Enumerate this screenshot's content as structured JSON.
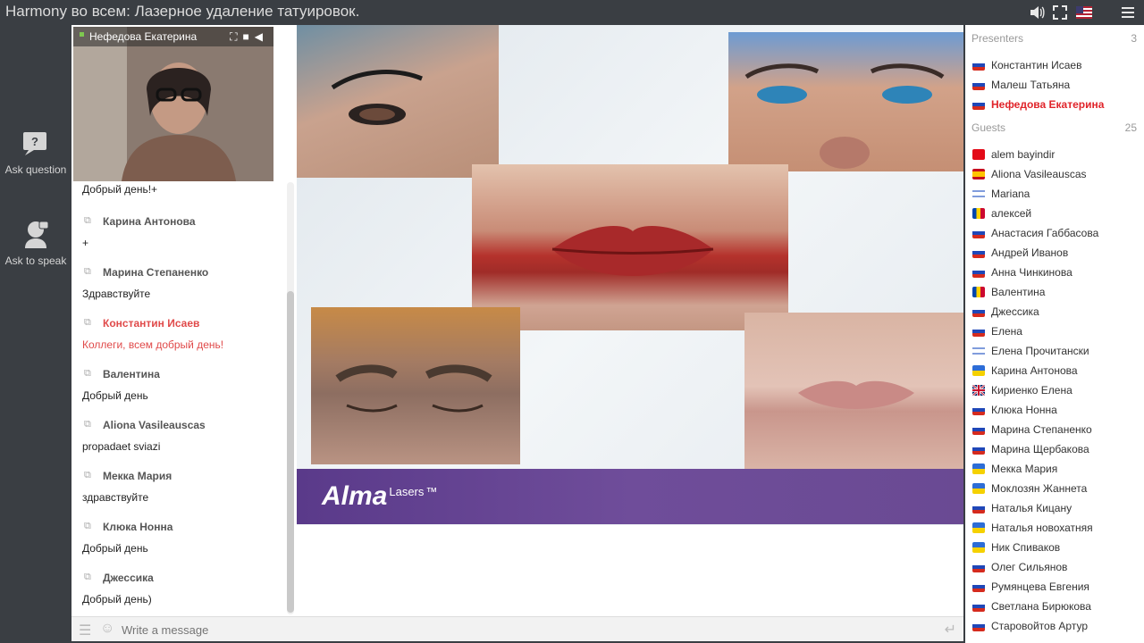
{
  "app": {
    "title": "Harmony во всем: Лазерное удаление татуировок."
  },
  "topbar": {
    "controls": [
      "volume-icon",
      "fullscreen-icon",
      "us-flag-icon",
      "menu-icon"
    ]
  },
  "leftrail": {
    "ask_question": "Ask question",
    "ask_speak": "Ask to speak"
  },
  "video": {
    "name": "Нефедова Екатерина",
    "icons": [
      "fullscreen-icon",
      "camera-icon",
      "volume-icon"
    ]
  },
  "chat": {
    "partial_first": "Добрый день!+",
    "messages": [
      {
        "author": "Карина Антонова",
        "text": "+",
        "highlight": false
      },
      {
        "author": "Марина Степаненко",
        "text": "Здравствуйте",
        "highlight": false
      },
      {
        "author": "Константин Исаев",
        "text": "Коллеги, всем добрый день!",
        "highlight": true
      },
      {
        "author": "Валентина",
        "text": "Добрый день",
        "highlight": false
      },
      {
        "author": "Aliona Vasileauscas",
        "text": "propadaet sviazi",
        "highlight": false
      },
      {
        "author": "Мекка Мария",
        "text": "здравствуйте",
        "highlight": false
      },
      {
        "author": "Клюка Нонна",
        "text": "Добрый день",
        "highlight": false
      },
      {
        "author": "Джессика",
        "text": "Добрый день)",
        "highlight": false
      }
    ]
  },
  "input": {
    "placeholder": "Write a message"
  },
  "slide": {
    "brand": "Alma",
    "brand_sub": "Lasers",
    "brand_tm": "™"
  },
  "presenters": {
    "label": "Presenters",
    "count": "3",
    "items": [
      {
        "name": "Константин Исаев",
        "flag": "ru",
        "highlight": false
      },
      {
        "name": "Малеш Татьяна",
        "flag": "ru",
        "highlight": false
      },
      {
        "name": "Нефедова Екатерина",
        "flag": "ru",
        "highlight": true
      }
    ]
  },
  "guests": {
    "label": "Guests",
    "count": "25",
    "items": [
      {
        "name": "alem bayindir",
        "flag": "tr"
      },
      {
        "name": "Aliona Vasileauscas",
        "flag": "es"
      },
      {
        "name": "Mariana",
        "flag": "il"
      },
      {
        "name": "алексей",
        "flag": "md"
      },
      {
        "name": "Анастасия Габбасова",
        "flag": "ru"
      },
      {
        "name": "Андрей Иванов",
        "flag": "ru"
      },
      {
        "name": "Анна Чинкинова",
        "flag": "ru"
      },
      {
        "name": "Валентина",
        "flag": "md"
      },
      {
        "name": "Джессика",
        "flag": "ru"
      },
      {
        "name": "Елена",
        "flag": "ru"
      },
      {
        "name": "Елена Прочитански",
        "flag": "il"
      },
      {
        "name": "Карина Антонова",
        "flag": "ua"
      },
      {
        "name": "Кириенко Елена",
        "flag": "gb"
      },
      {
        "name": "Клюка Нонна",
        "flag": "ru"
      },
      {
        "name": "Марина Степаненко",
        "flag": "ru"
      },
      {
        "name": "Марина Щербакова",
        "flag": "ru"
      },
      {
        "name": "Мекка Мария",
        "flag": "ua"
      },
      {
        "name": "Моклозян Жаннета",
        "flag": "ua"
      },
      {
        "name": "Наталья Кицану",
        "flag": "ru"
      },
      {
        "name": "Наталья новохатняя",
        "flag": "ua"
      },
      {
        "name": "Ник Спиваков",
        "flag": "ua"
      },
      {
        "name": "Олег Сильянов",
        "flag": "ru"
      },
      {
        "name": "Румянцева Евгения",
        "flag": "ru"
      },
      {
        "name": "Светлана Бирюкова",
        "flag": "ru"
      },
      {
        "name": "Старовойтов Артур",
        "flag": "ru"
      }
    ]
  },
  "colors": {
    "highlight": "#e0242a",
    "brand_purple": "#6a4a93",
    "bg_dark": "#3a3e43"
  }
}
